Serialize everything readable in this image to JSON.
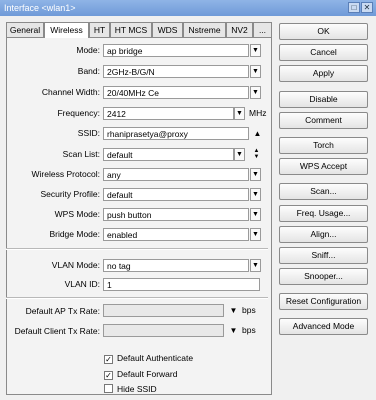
{
  "window": {
    "title": "Interface <wlan1>"
  },
  "tabs": [
    "General",
    "Wireless",
    "HT",
    "HT MCS",
    "WDS",
    "Nstreme",
    "NV2",
    "..."
  ],
  "fields": {
    "mode": {
      "label": "Mode:",
      "value": "ap bridge"
    },
    "band": {
      "label": "Band:",
      "value": "2GHz-B/G/N"
    },
    "channel_width": {
      "label": "Channel Width:",
      "value": "20/40MHz Ce"
    },
    "frequency": {
      "label": "Frequency:",
      "value": "2412",
      "unit": "MHz"
    },
    "ssid": {
      "label": "SSID:",
      "value": "rhaniprasetya@proxy"
    },
    "scan_list": {
      "label": "Scan List:",
      "value": "default"
    },
    "wireless_protocol": {
      "label": "Wireless Protocol:",
      "value": "any"
    },
    "security_profile": {
      "label": "Security Profile:",
      "value": "default"
    },
    "wps_mode": {
      "label": "WPS Mode:",
      "value": "push button"
    },
    "bridge_mode": {
      "label": "Bridge Mode:",
      "value": "enabled"
    },
    "vlan_mode": {
      "label": "VLAN Mode:",
      "value": "no tag"
    },
    "vlan_id": {
      "label": "VLAN ID:",
      "value": "1"
    },
    "default_ap_tx_rate": {
      "label": "Default AP Tx Rate:",
      "value": "",
      "unit": "bps"
    },
    "default_client_tx_rate": {
      "label": "Default Client Tx Rate:",
      "value": "",
      "unit": "bps"
    }
  },
  "checkboxes": [
    {
      "label": "Default Authenticate",
      "checked": true
    },
    {
      "label": "Default Forward",
      "checked": true
    },
    {
      "label": "Hide SSID",
      "checked": false
    }
  ],
  "buttons": [
    "OK",
    "Cancel",
    "Apply",
    "Disable",
    "Comment",
    "Torch",
    "WPS Accept",
    "Scan...",
    "Freq. Usage...",
    "Align...",
    "Sniff...",
    "Snooper...",
    "Reset Configuration",
    "Advanced Mode"
  ],
  "icons": {
    "dropdown": "triangle-down-icon",
    "collapse": "triangle-up-icon",
    "updown": "up-down-arrows-icon",
    "check": "checkmark-icon"
  }
}
